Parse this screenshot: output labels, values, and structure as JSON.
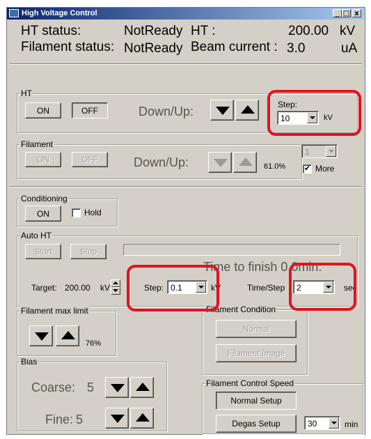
{
  "window": {
    "title": "High Voltage Control",
    "minimize": "_",
    "maximize": "□",
    "close": "x"
  },
  "status": {
    "ht_label": "HT status:",
    "ht_value": "NotReady",
    "ht_kv_label": "HT :",
    "ht_kv_value": "200.00",
    "ht_kv_unit": "kV",
    "filament_label": "Filament status:",
    "filament_value": "NotReady",
    "beam_label": "Beam current :",
    "beam_value": "3.0",
    "beam_unit": "uA"
  },
  "ht_group": {
    "legend": "HT",
    "on": "ON",
    "off": "OFF",
    "downup": "Down/Up:",
    "step_label": "Step:",
    "step_value": "10",
    "step_unit": "kV"
  },
  "filament_group": {
    "legend": "Filament",
    "on": "ON",
    "off": "OFF",
    "downup": "Down/Up:",
    "percent": "61.0%",
    "select_value": "1",
    "more_label": "More",
    "more_checked": true
  },
  "conditioning_group": {
    "legend": "Conditioning",
    "on": "ON",
    "hold_label": "Hold",
    "hold_checked": false
  },
  "auto_ht": {
    "legend": "Auto HT",
    "start": "Start",
    "stop": "Stop",
    "progress": 0,
    "time_to_finish": "Time to finish 0.0min.",
    "target_label": "Target:",
    "target_value": "200.00",
    "target_unit": "kV",
    "step_label": "Step:",
    "step_value": "0.1",
    "step_unit": "kV",
    "time_step_label": "Time/Step",
    "time_step_value": "2",
    "time_step_unit": "sec"
  },
  "filament_max_limit": {
    "legend": "Filament max limit",
    "percent": "76%"
  },
  "filament_condition": {
    "legend": "Filament Condition",
    "normal": "Normal",
    "image": "Filament Image"
  },
  "bias": {
    "legend": "Bias",
    "coarse_label": "Coarse:",
    "coarse_value": "5",
    "fine_label": "Fine:",
    "fine_value": "5"
  },
  "filament_speed": {
    "legend": "Filament Control Speed",
    "normal_setup": "Normal Setup",
    "degas_setup": "Degas Setup",
    "minutes_value": "30",
    "minutes_unit": "min"
  },
  "colors": {
    "highlight": "#e0141e",
    "window_bg": "#d4d0c8",
    "title_bar": "#0a246a"
  }
}
